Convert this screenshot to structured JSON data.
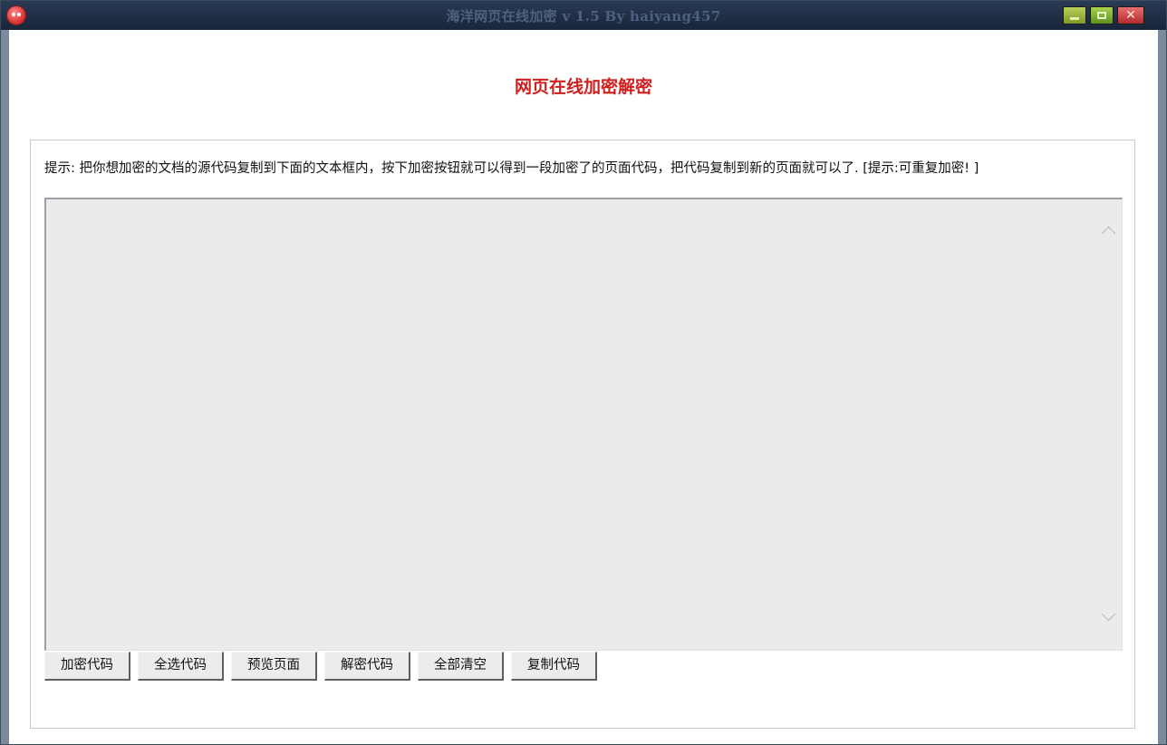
{
  "window": {
    "title": "海洋网页在线加密 v 1.5  By haiyang457",
    "icons": {
      "app": "app-icon",
      "minimize": "minimize-icon",
      "maximize": "maximize-icon",
      "close": "close-icon"
    },
    "close_glyph": "✕"
  },
  "page": {
    "heading": "网页在线加密解密",
    "hint": "提示: 把你想加密的文档的源代码复制到下面的文本框内，按下加密按钮就可以得到一段加密了的页面代码，把代码复制到新的页面就可以了. [提示:可重复加密! ]"
  },
  "editor": {
    "value": "",
    "placeholder": ""
  },
  "buttons": {
    "encrypt": "加密代码",
    "select_all": "全选代码",
    "preview": "预览页面",
    "decrypt": "解密代码",
    "clear_all": "全部清空",
    "copy": "复制代码"
  },
  "colors": {
    "heading_red": "#d01f1f",
    "titlebar": "#1f2e45",
    "textarea_bg": "#ebebeb"
  }
}
